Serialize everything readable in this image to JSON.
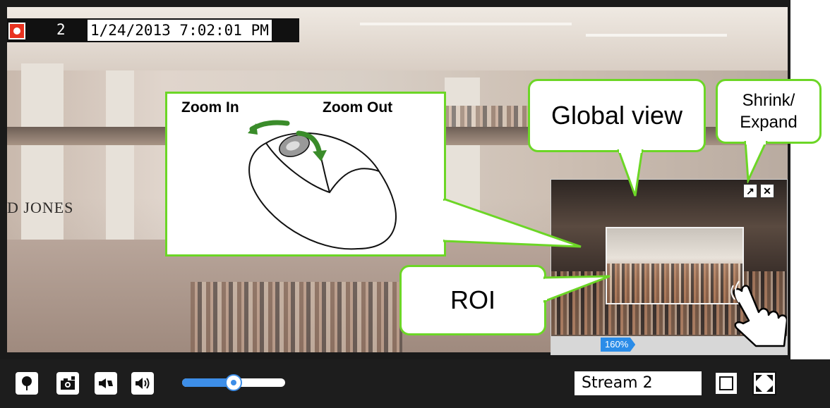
{
  "status": {
    "channel": "2",
    "timestamp": "1/24/2013 7:02:01 PM"
  },
  "background": {
    "store_sign": "D JONES"
  },
  "mouse_callout": {
    "zoom_in_label": "Zoom In",
    "zoom_out_label": "Zoom Out"
  },
  "callouts": {
    "global_view": "Global view",
    "shrink_expand_line1": "Shrink/",
    "shrink_expand_line2": "Expand",
    "roi": "ROI"
  },
  "global_panel": {
    "zoom_level": "160%",
    "expand_icon": "↗",
    "close_icon": "✕"
  },
  "controls": {
    "volume_level": 0.5,
    "stream": "Stream 2"
  },
  "colors": {
    "callout_border": "#6cd626",
    "accent": "#3d8ee8",
    "record_red": "#e8321f"
  }
}
